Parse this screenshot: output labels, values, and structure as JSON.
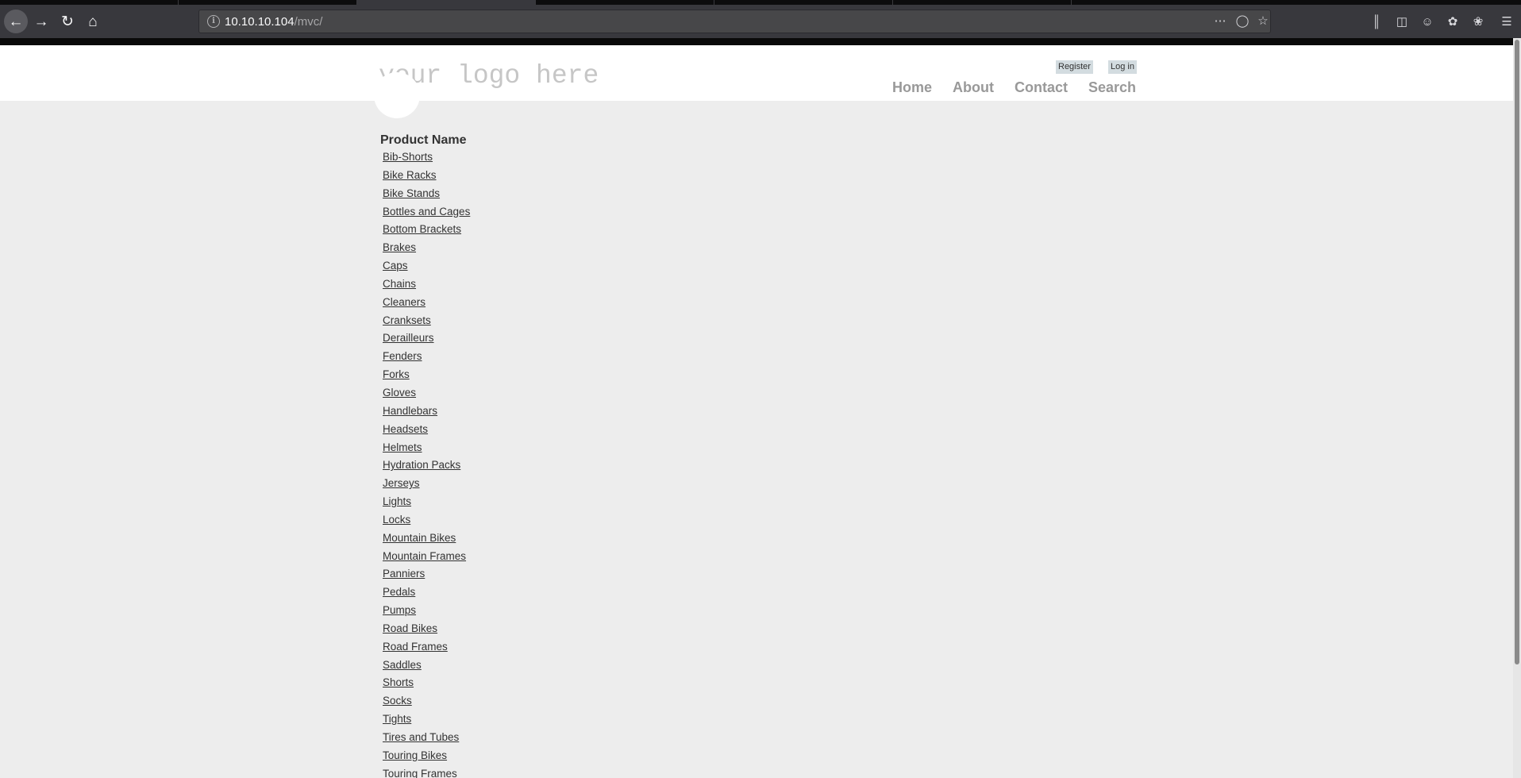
{
  "browser": {
    "url_host": "10.10.10.104",
    "url_path": "/mvc/",
    "icons": {
      "back": "arrow-left",
      "forward": "arrow-right",
      "reload": "reload",
      "home": "home",
      "page_actions": "ellipsis",
      "pocket": "pocket",
      "bookmark": "star",
      "library": "library",
      "sidebar": "sidebar",
      "account": "account",
      "extension1": "extension",
      "extension2": "extension",
      "menu": "hamburger"
    }
  },
  "site": {
    "logo_text": "your logo here",
    "register_label": "Register",
    "login_label": "Log in",
    "nav": [
      "Home",
      "About",
      "Contact",
      "Search"
    ]
  },
  "products": {
    "header": "Product Name",
    "items": [
      "Bib-Shorts",
      "Bike Racks",
      "Bike Stands",
      "Bottles and Cages",
      "Bottom Brackets",
      "Brakes",
      "Caps",
      "Chains",
      "Cleaners",
      "Cranksets",
      "Derailleurs",
      "Fenders",
      "Forks",
      "Gloves",
      "Handlebars",
      "Headsets",
      "Helmets",
      "Hydration Packs",
      "Jerseys",
      "Lights",
      "Locks",
      "Mountain Bikes",
      "Mountain Frames",
      "Panniers",
      "Pedals",
      "Pumps",
      "Road Bikes",
      "Road Frames",
      "Saddles",
      "Shorts",
      "Socks",
      "Tights",
      "Tires and Tubes",
      "Touring Bikes",
      "Touring Frames"
    ]
  }
}
